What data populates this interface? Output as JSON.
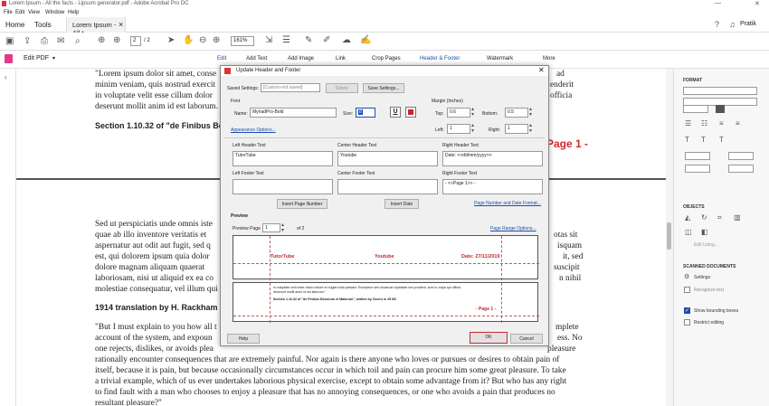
{
  "window": {
    "title": "Lorem Ipsum - All the facts - Lipsum generator.pdf - Adobe Acrobat Pro DC",
    "minimize": "—",
    "close": "✕"
  },
  "menu": [
    "File",
    "Edit",
    "View",
    "Window",
    "Help"
  ],
  "tabs": {
    "home": "Home",
    "tools": "Tools",
    "doc": "Lorem Ipsum - All t...",
    "close": "×",
    "user": "Pratik"
  },
  "toolbar": {
    "page_current": "2",
    "page_total": "/ 2",
    "zoom": "161%"
  },
  "editbar": {
    "title": "Edit PDF",
    "items": [
      "Edit",
      "Add Text",
      "Add Image",
      "Link",
      "Crop Pages",
      "Header & Footer",
      "Watermark",
      "More"
    ]
  },
  "doc": {
    "lines_top": [
      "\"Lorem ipsum dolor sit amet, conse",
      "minim veniam, quis nostrud exercit",
      "in voluptate velit esse cillum dolor",
      "deserunt mollit anim id est laborum."
    ],
    "right_top": [
      "ad",
      "enderit",
      "officia"
    ],
    "section_heading": "Section 1.10.32 of \"de Finibus Bono",
    "page_marker": "Page 1 -",
    "lines_mid": [
      "Sed ut perspiciatis unde omnis iste",
      "quae ab illo inventore veritatis et",
      "aspernatur aut odit aut fugit, sed q",
      "est, qui dolorem ipsum quia dolor",
      "dolore magnam aliquam quaerat",
      "laboriosam, nisi ut aliquid ex ea co",
      "molestiae consequatur, vel illum qui"
    ],
    "right_mid": [
      "otas sit",
      "isquam",
      "it, sed",
      "suscipit",
      "n nihil"
    ],
    "translation_heading": "1914 translation by H. Rackham",
    "lines_bottom": [
      "\"But I must explain to you how all t",
      "account of the system, and expoun",
      "one rejects, dislikes, or avoids plea",
      "rationally encounter consequences that are extremely painful. Nor again is there anyone who loves or pursues or desires to obtain pain of",
      "itself, because it is pain, but because occasionally circumstances occur in which toil and pain can procure him some great pleasure. To take",
      "a trivial example, which of us ever undertakes laborious physical exercise, except to obtain some advantage from it? But who has any right",
      "to find fault with a man who chooses to enjoy a pleasure that has no annoying consequences, or one who avoids a pain that produces no",
      "resultant pleasure?\""
    ],
    "right_bottom": [
      "mplete",
      "ess. No",
      "pleasure"
    ]
  },
  "dialog": {
    "title": "Update Header and Footer",
    "saved_settings_label": "Saved Settings:",
    "saved_settings_value": "[Custom-not saved]",
    "delete": "Delete",
    "save_settings": "Save Settings...",
    "font_label": "Font",
    "name_label": "Name:",
    "font_name": "MyriadPro-Bold",
    "size_label": "Size:",
    "size_value": "8",
    "appearance": "Appearance Options...",
    "margin_label": "Margin (Inches)",
    "top_label": "Top:",
    "top_value": "0.6",
    "bottom_label": "Bottom:",
    "bottom_value": "0.5",
    "left_label": "Left:",
    "left_value": "1",
    "right_label": "Right:",
    "right_value": "1",
    "lh_label": "Left Header Text",
    "lh_value": "TutorTube",
    "ch_label": "Center Header Text",
    "ch_value": "Youtube",
    "rh_label": "Right Header Text",
    "rh_value": "Date: <<dd/mm/yyyy>>",
    "lf_label": "Left Footer Text",
    "lf_value": "",
    "cf_label": "Center Footer Text",
    "cf_value": "",
    "rf_label": "Right Footer Text",
    "rf_value": "- <<Page 1>> -",
    "insert_page": "Insert Page Number",
    "insert_date": "Insert Date",
    "page_number_format": "Page Number and Date Format...",
    "preview_label": "Preview",
    "preview_page_label": "Preview Page",
    "preview_page": "1",
    "preview_of": "of 2",
    "page_range": "Page Range Options...",
    "prev_left": "TutorTube",
    "prev_center": "Youtube",
    "prev_right": "Date: 27/11/2019",
    "prev_text1": "in voluptate velit esse cillum dolore eu fugiat nulla pariatur. Excepteur sint occaecat cupidatat non proident, sunt in culpa qui officia",
    "prev_text2": "deserunt mollit anim id est laborum.\"",
    "prev_heading": "Section 1.10.32 of \"de Finibus Bonorum et Malorum\", written by Cicero in 45 BC",
    "prev_footer": "- Page 1 -",
    "help": "Help",
    "ok": "OK",
    "cancel": "Cancel",
    "accent": "#c6272e"
  },
  "panel": {
    "format": "FORMAT",
    "objects": "OBJECTS",
    "edit_using": "Edit Using...",
    "scanned": "SCANNED DOCUMENTS",
    "settings": "Settings",
    "recognize": "Recognize text",
    "show_bounding": "Show bounding boxes",
    "restrict": "Restrict editing"
  }
}
